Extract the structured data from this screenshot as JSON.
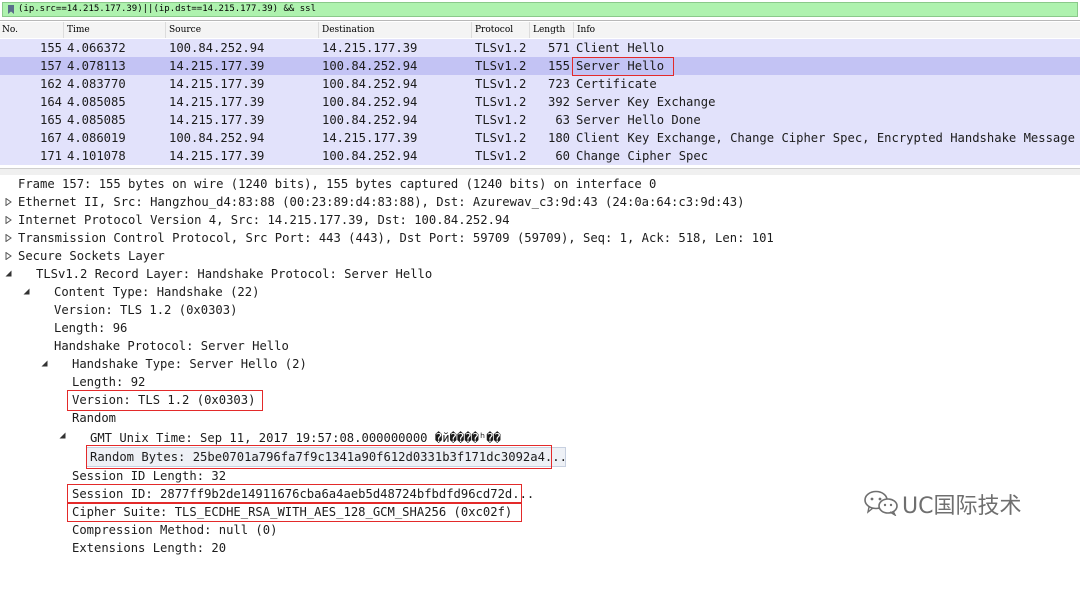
{
  "filter": {
    "expression": "(ip.src==14.215.177.39)||(ip.dst==14.215.177.39) && ssl"
  },
  "packet_list": {
    "columns": [
      "No.",
      "Time",
      "Source",
      "Destination",
      "Protocol",
      "Length",
      "Info"
    ],
    "rows": [
      {
        "no": "155",
        "time": "4.066372",
        "src": "100.84.252.94",
        "dst": "14.215.177.39",
        "proto": "TLSv1.2",
        "len": "571",
        "info": "Client Hello"
      },
      {
        "no": "157",
        "time": "4.078113",
        "src": "14.215.177.39",
        "dst": "100.84.252.94",
        "proto": "TLSv1.2",
        "len": "155",
        "info": "Server Hello"
      },
      {
        "no": "162",
        "time": "4.083770",
        "src": "14.215.177.39",
        "dst": "100.84.252.94",
        "proto": "TLSv1.2",
        "len": "723",
        "info": "Certificate"
      },
      {
        "no": "164",
        "time": "4.085085",
        "src": "14.215.177.39",
        "dst": "100.84.252.94",
        "proto": "TLSv1.2",
        "len": "392",
        "info": "Server Key Exchange"
      },
      {
        "no": "165",
        "time": "4.085085",
        "src": "14.215.177.39",
        "dst": "100.84.252.94",
        "proto": "TLSv1.2",
        "len": "63",
        "info": "Server Hello Done"
      },
      {
        "no": "167",
        "time": "4.086019",
        "src": "100.84.252.94",
        "dst": "14.215.177.39",
        "proto": "TLSv1.2",
        "len": "180",
        "info": "Client Key Exchange, Change Cipher Spec, Encrypted Handshake Message"
      },
      {
        "no": "171",
        "time": "4.101078",
        "src": "14.215.177.39",
        "dst": "100.84.252.94",
        "proto": "TLSv1.2",
        "len": "60",
        "info": "Change Cipher Spec"
      }
    ]
  },
  "details": {
    "frame": "Frame 157: 155 bytes on wire (1240 bits), 155 bytes captured (1240 bits) on interface 0",
    "ethernet": "Ethernet II, Src: Hangzhou_d4:83:88 (00:23:89:d4:83:88), Dst: Azurewav_c3:9d:43 (24:0a:64:c3:9d:43)",
    "ip": "Internet Protocol Version 4, Src: 14.215.177.39, Dst: 100.84.252.94",
    "tcp": "Transmission Control Protocol, Src Port: 443 (443), Dst Port: 59709 (59709), Seq: 1, Ack: 518, Len: 101",
    "ssl": "Secure Sockets Layer",
    "record_layer": "TLSv1.2 Record Layer: Handshake Protocol: Server Hello",
    "content_type": "Content Type: Handshake (22)",
    "version": "Version: TLS 1.2 (0x0303)",
    "length": "Length: 96",
    "handshake": "Handshake Protocol: Server Hello",
    "handshake_type": "Handshake Type: Server Hello (2)",
    "hs_length": "Length: 92",
    "hs_version": "Version: TLS 1.2 (0x0303)",
    "random": "Random",
    "gmt": "GMT Unix Time: Sep 11, 2017 19:57:08.000000000 �й����ʰ��",
    "random_bytes": "Random Bytes: 25be0701a796fa7f9c1341a90f612d0331b3f171dc3092a4...",
    "session_id_length": "Session ID Length: 32",
    "session_id": "Session ID: 2877ff9b2de14911676cba6a4aeb5d48724bfbdfd96cd72d...",
    "cipher_suite": "Cipher Suite: TLS_ECDHE_RSA_WITH_AES_128_GCM_SHA256 (0xc02f)",
    "compression": "Compression Method: null (0)",
    "extensions_length": "Extensions Length: 20"
  },
  "watermark": {
    "text": "UC国际技术",
    "icon": "wechat-icon"
  },
  "colors": {
    "highlight": "#e32a2a",
    "filter_ok": "#aef2ae",
    "row_bg": "#e2e2fb",
    "row_selected": "#c3c3f4"
  }
}
